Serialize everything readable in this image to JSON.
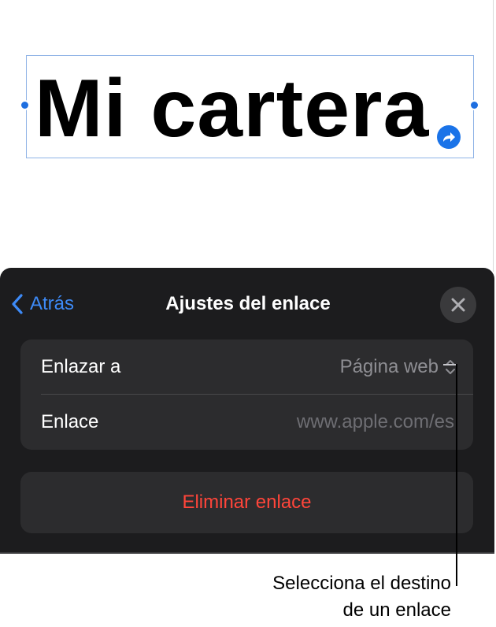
{
  "canvas": {
    "textbox_text": "Mi cartera"
  },
  "panel": {
    "back_label": "Atrás",
    "title": "Ajustes del enlace",
    "link_to_label": "Enlazar a",
    "link_to_value": "Página web",
    "link_label": "Enlace",
    "link_placeholder": "www.apple.com/es",
    "remove_label": "Eliminar enlace"
  },
  "callout": {
    "line1": "Selecciona el destino",
    "line2": "de un enlace"
  },
  "colors": {
    "accent": "#3d8af7",
    "destructive": "#ff453a",
    "panel_bg": "#1c1c1e",
    "group_bg": "#2c2c2e"
  },
  "icons": {
    "back": "chevron-left-icon",
    "close": "close-icon",
    "link_badge": "link-arrow-icon",
    "popup": "chevron-up-down-icon"
  }
}
